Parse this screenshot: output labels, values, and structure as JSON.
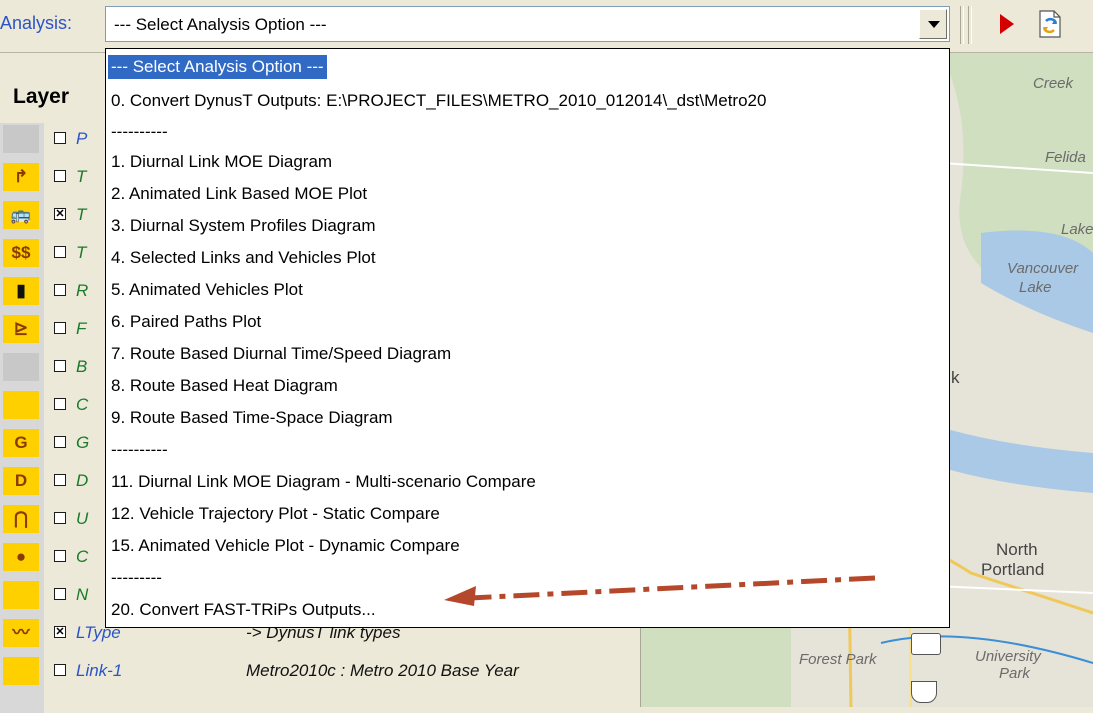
{
  "toolbar": {
    "analysis_label": "Analysis:",
    "combo_value": "--- Select Analysis Option ---"
  },
  "layer_panel": {
    "title": "Layer",
    "rows": [
      {
        "icon": "blank-icon",
        "checked": false,
        "name": "P",
        "desc": ""
      },
      {
        "icon": "turn-arrow-icon",
        "checked": false,
        "name": "T",
        "desc": ""
      },
      {
        "icon": "bus-icon",
        "checked": true,
        "name": "T",
        "desc": ""
      },
      {
        "icon": "dollar-icon",
        "checked": false,
        "name": "T",
        "desc": ""
      },
      {
        "icon": "traffic-light-icon",
        "checked": false,
        "name": "R",
        "desc": ""
      },
      {
        "icon": "ramp-icon",
        "checked": false,
        "name": "F",
        "desc": ""
      },
      {
        "icon": "blank-icon",
        "checked": false,
        "name": "B",
        "desc": ""
      },
      {
        "icon": "blank-icon",
        "checked": false,
        "name": "C",
        "desc": ""
      },
      {
        "icon": "g-icon",
        "checked": false,
        "name": "G",
        "desc": ""
      },
      {
        "icon": "d-icon",
        "checked": false,
        "name": "D",
        "desc": ""
      },
      {
        "icon": "u-turn-icon",
        "checked": false,
        "name": "U",
        "desc": ""
      },
      {
        "icon": "signal-icon",
        "checked": false,
        "name": "C",
        "desc": ""
      },
      {
        "icon": "blank-icon",
        "checked": false,
        "name": "N",
        "desc": ""
      },
      {
        "icon": "line-chart-icon",
        "checked": true,
        "name": "LType",
        "desc": "-> DynusT link types"
      },
      {
        "icon": "blank-icon",
        "checked": false,
        "name": "Link-1",
        "desc": "Metro2010c : Metro 2010 Base Year"
      }
    ]
  },
  "map": {
    "labels": [
      "Creek",
      "Felida",
      "Lake",
      "Vancouver",
      "Lake",
      "k",
      "North",
      "Portland",
      "Forest Park",
      "University",
      "Park"
    ]
  },
  "dropdown": {
    "items": [
      "--- Select Analysis Option ---",
      "0. Convert DynusT Outputs: E:\\PROJECT_FILES\\METRO_2010_012014\\_dst\\Metro20",
      "----------",
      "1. Diurnal Link MOE Diagram",
      "2. Animated Link Based MOE Plot",
      "3. Diurnal System Profiles Diagram",
      "4. Selected Links and Vehicles Plot",
      "5. Animated Vehicles Plot",
      "6. Paired Paths Plot",
      "7. Route Based Diurnal Time/Speed Diagram",
      "8. Route Based Heat Diagram",
      "9. Route Based Time-Space Diagram",
      "----------",
      "11. Diurnal Link MOE Diagram - Multi-scenario Compare",
      "12. Vehicle Trajectory Plot - Static Compare",
      "15. Animated Vehicle Plot - Dynamic Compare",
      "---------",
      "20. Convert FAST-TRiPs Outputs..."
    ]
  },
  "colors": {
    "selection": "#316ac5",
    "arrow": "#b5482a",
    "label_blue": "#2b54c8"
  }
}
